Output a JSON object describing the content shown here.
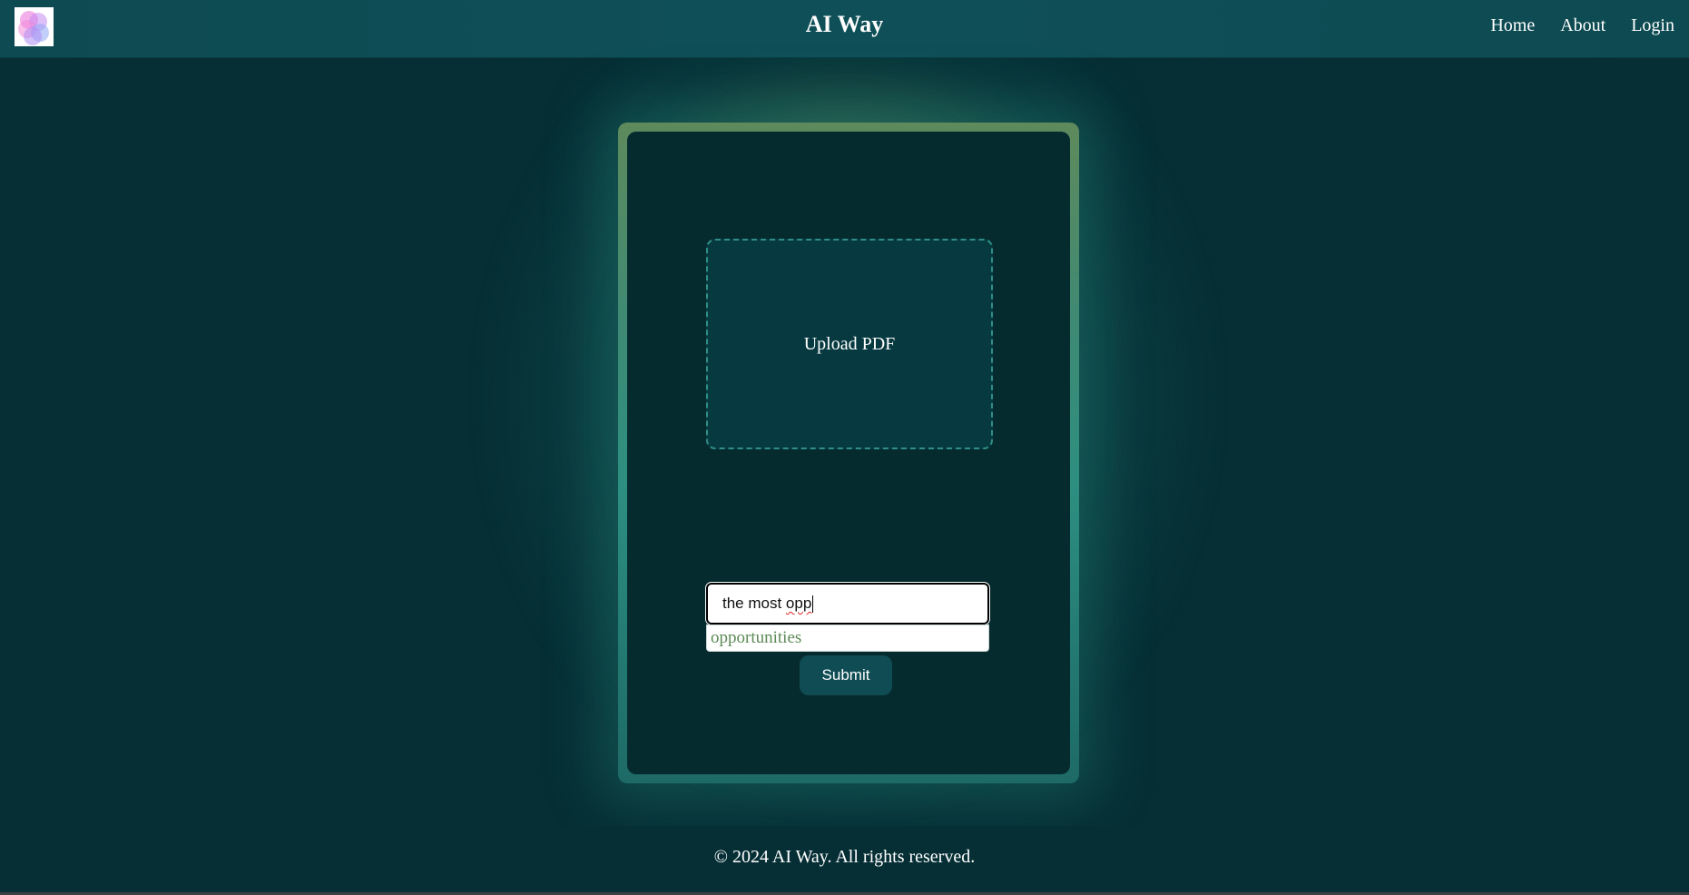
{
  "header": {
    "title": "AI Way",
    "logo_icon": "flower-logo-icon",
    "nav": [
      {
        "label": "Home"
      },
      {
        "label": "About"
      },
      {
        "label": "Login"
      }
    ]
  },
  "main": {
    "upload_label": "Upload PDF",
    "query": {
      "value_prefix": "the most ",
      "value_misspelled": "opp"
    },
    "suggestion": "opportunities",
    "submit_label": "Submit"
  },
  "footer": {
    "text": "© 2024 AI Way. All rights reserved."
  },
  "colors": {
    "background": "#062f35",
    "navbar": "#0f5058",
    "card": "#062b2f",
    "accent_border": "#2f8f86",
    "button": "#0f4c53",
    "suggestion_text": "#5b8a55"
  }
}
